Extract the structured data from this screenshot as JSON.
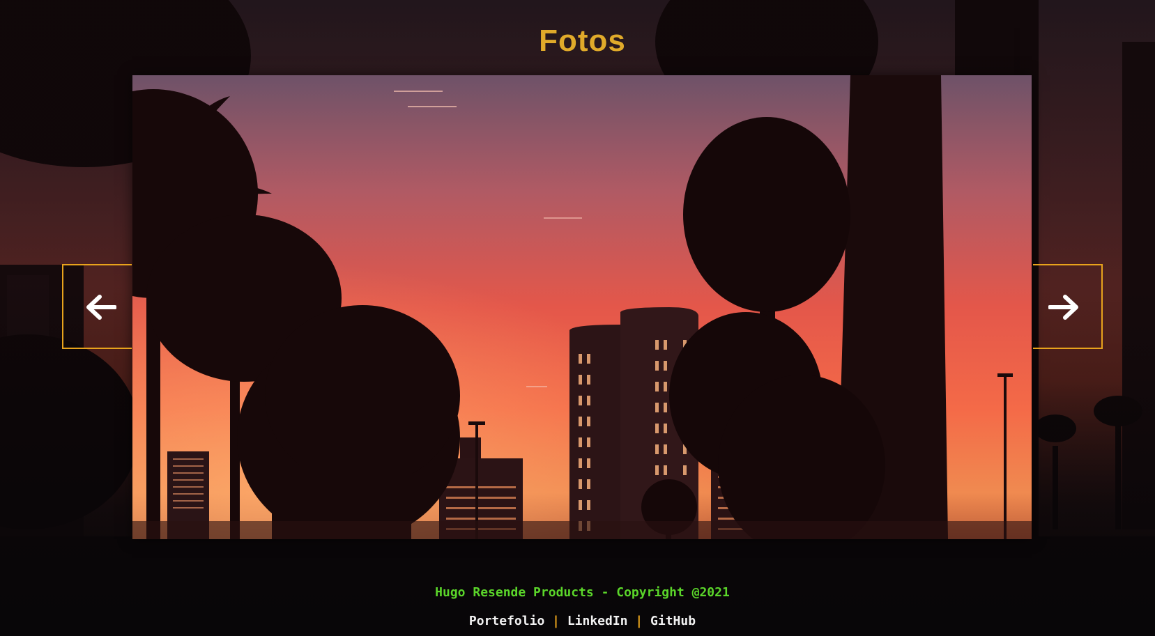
{
  "header": {
    "title": "Fotos"
  },
  "gallery": {
    "prev_icon": "arrow-left-icon",
    "next_icon": "arrow-right-icon",
    "current_photo": "sunset-palm-trees-city-skyline"
  },
  "footer": {
    "copyright": "Hugo Resende Products - Copyright @2021",
    "links": [
      {
        "label": "Portefolio"
      },
      {
        "label": "LinkedIn"
      },
      {
        "label": "GitHub"
      }
    ],
    "separator": "|"
  },
  "colors": {
    "title": "#e0aa2a",
    "nav_border": "#e8a31c",
    "copyright": "#5bd62a",
    "links": "#f2f2f2"
  }
}
